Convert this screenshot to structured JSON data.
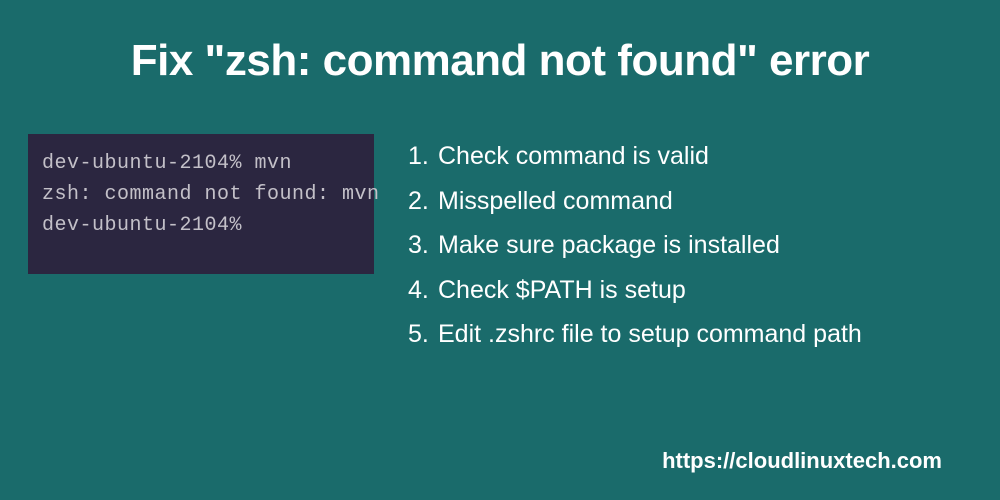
{
  "heading": "Fix \"zsh: command not found\" error",
  "terminal": {
    "lines": [
      "dev-ubuntu-2104% mvn",
      "zsh: command not found: mvn",
      "dev-ubuntu-2104%"
    ]
  },
  "steps": [
    {
      "num": "1.",
      "text": "Check command is valid"
    },
    {
      "num": "2.",
      "text": "Misspelled command"
    },
    {
      "num": "3.",
      "text": "Make sure package is installed"
    },
    {
      "num": "4.",
      "text": "Check $PATH is setup"
    },
    {
      "num": "5.",
      "text": "Edit .zshrc file to setup command path"
    }
  ],
  "footer_url": "https://cloudlinuxtech.com"
}
